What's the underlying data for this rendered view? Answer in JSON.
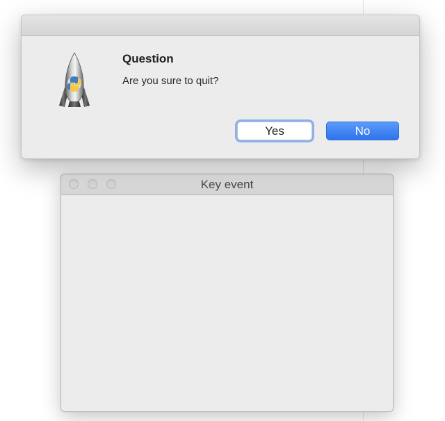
{
  "main_window": {
    "title": "Key event"
  },
  "dialog": {
    "title": "Question",
    "message": "Are you sure to quit?",
    "app_icon": "python-launcher-rocket-icon",
    "buttons": {
      "yes_label": "Yes",
      "no_label": "No"
    }
  },
  "colors": {
    "default_button": "#2f73ee",
    "focus_ring": "#8eb0e8",
    "window_background": "#ececec"
  }
}
